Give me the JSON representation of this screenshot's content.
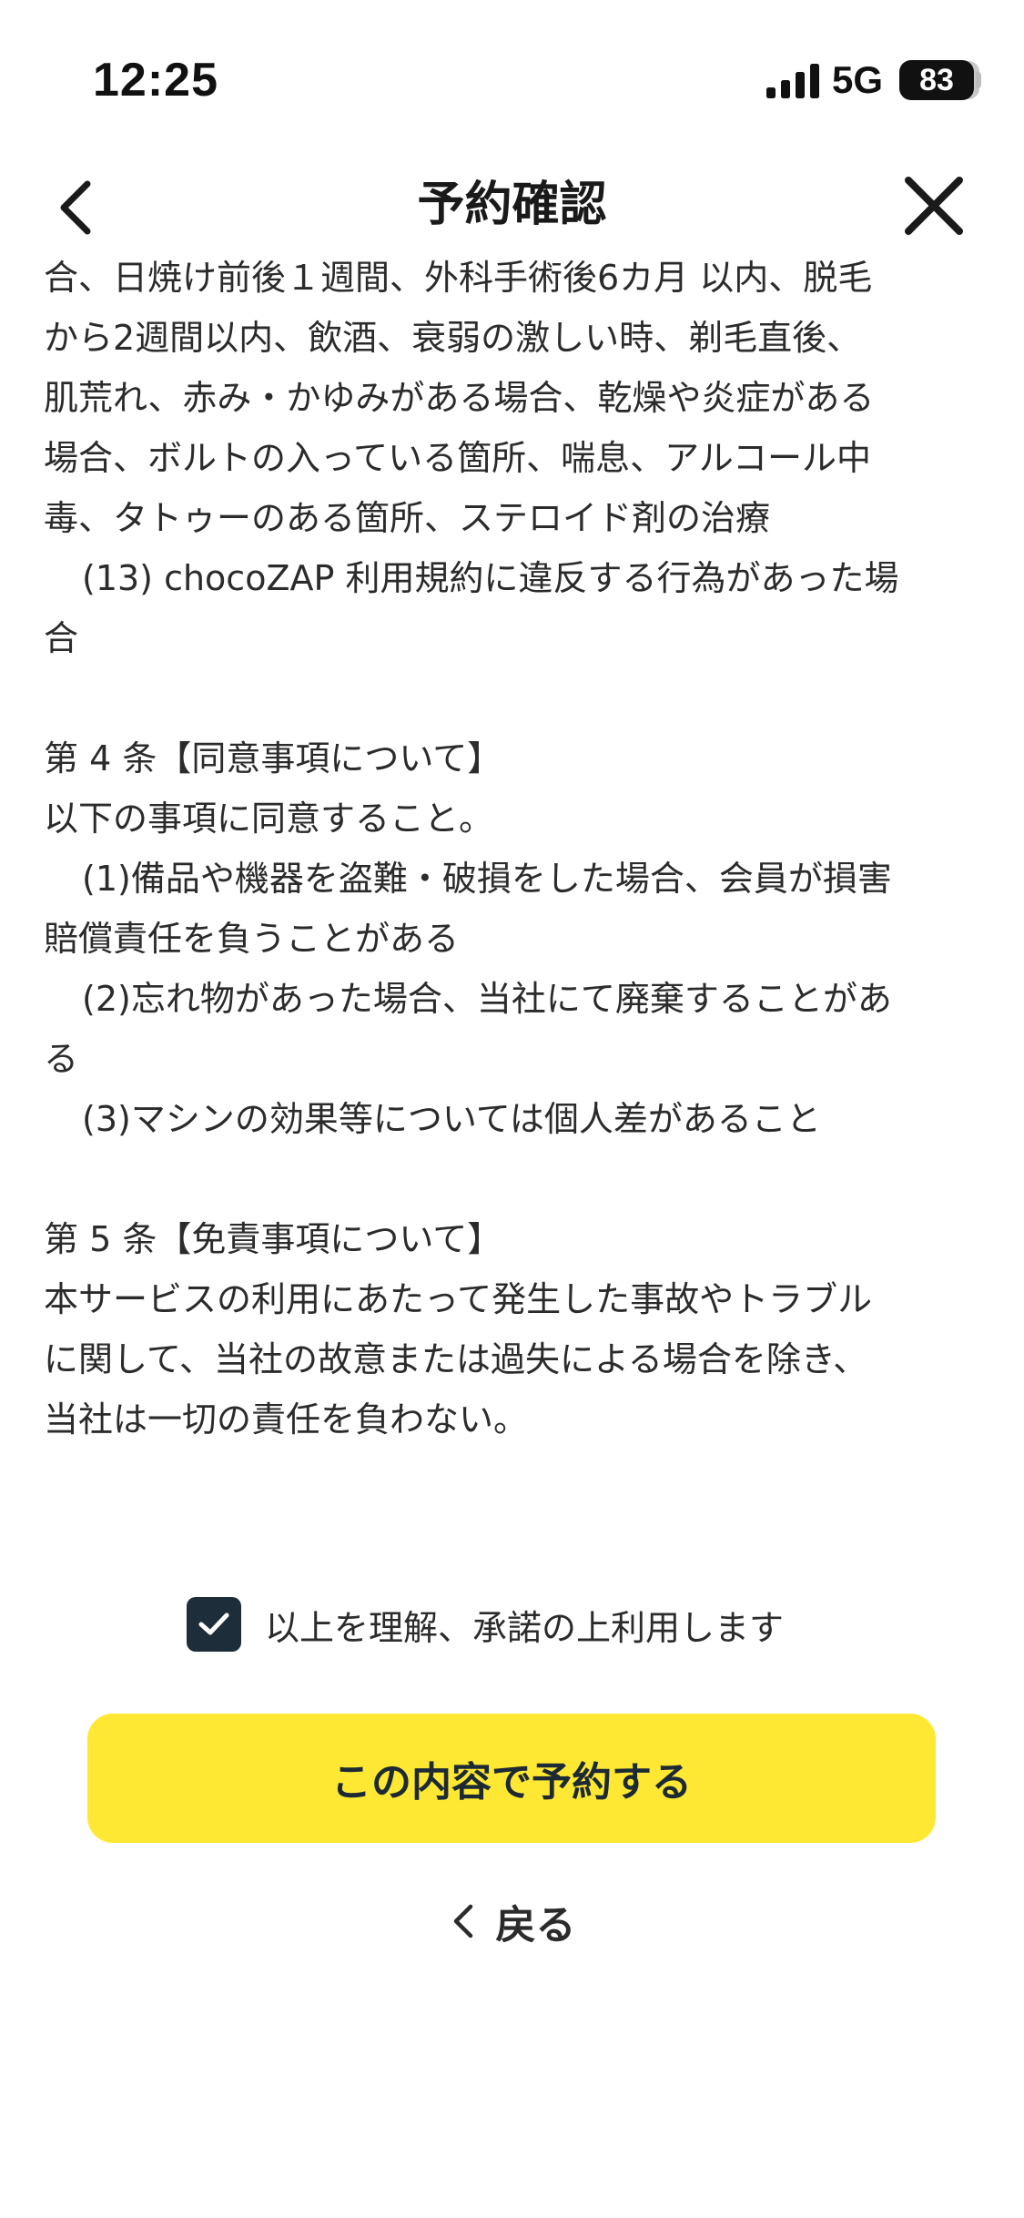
{
  "status_bar": {
    "time": "12:25",
    "network": "5G",
    "battery": "83"
  },
  "header": {
    "title": "予約確認"
  },
  "terms": {
    "lines": [
      "合、日焼け前後１週間、外科手術後6カ月 以内、脱毛",
      "から2週間以内、飲酒、衰弱の激しい時、剃毛直後、",
      "肌荒れ、赤み・かゆみがある場合、乾燥や炎症がある",
      "場合、ボルトの入っている箇所、喘息、アルコール中",
      "毒、タトゥーのある箇所、ステロイド剤の治療",
      "(13) chocoZAP 利用規約に違反する行為があった場",
      "合",
      "第 4 条【同意事項について】",
      "以下の事項に同意すること。",
      "(1)備品や機器を盗難・破損をした場合、会員が損害",
      "賠償責任を負うことがある",
      "(2)忘れ物があった場合、当社にて廃棄することがあ",
      "る",
      "(3)マシンの効果等については個人差があること",
      "第 5 条【免責事項について】",
      "本サービスの利用にあたって発生した事故やトラブル",
      "に関して、当社の故意または過失による場合を除き、",
      "当社は一切の責任を負わない。"
    ]
  },
  "agreement": {
    "label": "以上を理解、承諾の上利用します"
  },
  "actions": {
    "reserve_label": "この内容で予約する",
    "back_label": "戻る"
  },
  "colors": {
    "accent": "#ffe833",
    "checkbox": "#1d2d3a",
    "text": "#2b2b2b"
  }
}
